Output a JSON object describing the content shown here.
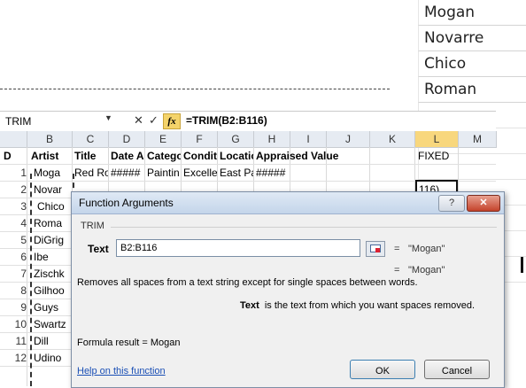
{
  "zoom_column": [
    "Mogan",
    "Novarre",
    "Chico",
    "Roman"
  ],
  "formula_bar": {
    "name_box": "TRIM",
    "cancel_glyph": "✕",
    "enter_glyph": "✓",
    "fx_label": "fx",
    "formula": "=TRIM(B2:B116)"
  },
  "columns": [
    "B",
    "C",
    "D",
    "E",
    "F",
    "G",
    "H",
    "I",
    "J",
    "K",
    "L",
    "M"
  ],
  "header_row": {
    "a_tail": "D",
    "artist": "Artist",
    "title": "Title",
    "date": "Date A",
    "category": "Catego",
    "condition": "Condit",
    "location": "Locatio",
    "appraised": "Appraised Value",
    "fixed": "FIXED"
  },
  "row1": {
    "title": "Red Ro",
    "date": "#####",
    "category": "Paintin",
    "condition": "Excelle",
    "location": "East Pa",
    "appraised": "#####"
  },
  "active_cell_text": "116)",
  "rows": [
    {
      "num": "1",
      "artist": "Moga"
    },
    {
      "num": "2",
      "artist": "Novar"
    },
    {
      "num": "3",
      "artist": "Chico"
    },
    {
      "num": "4",
      "artist": "Roma"
    },
    {
      "num": "5",
      "artist": "DiGrig"
    },
    {
      "num": "6",
      "artist": "Ibe"
    },
    {
      "num": "7",
      "artist": "Zischk"
    },
    {
      "num": "8",
      "artist": "Gilhoo"
    },
    {
      "num": "9",
      "artist": "Guys"
    },
    {
      "num": "10",
      "artist": "Swartz"
    },
    {
      "num": "11",
      "artist": "Dill"
    },
    {
      "num": "12",
      "artist": "Udino"
    }
  ],
  "dialog": {
    "title": "Function Arguments",
    "help_glyph": "?",
    "close_glyph": "✕",
    "function_name": "TRIM",
    "arg_label": "Text",
    "arg_value": "B2:B116",
    "arg_eq": "=",
    "arg_result": "\"Mogan\"",
    "res_eq": "=",
    "res_value": "\"Mogan\"",
    "description": "Removes all spaces from a text string except for single spaces between words.",
    "arg_desc_label": "Text",
    "arg_desc": "is the text from which you want spaces removed.",
    "formula_result_label": "Formula result =",
    "formula_result_value": "Mogan",
    "help_link": "Help on this function",
    "ok_label": "OK",
    "cancel_label": "Cancel"
  }
}
